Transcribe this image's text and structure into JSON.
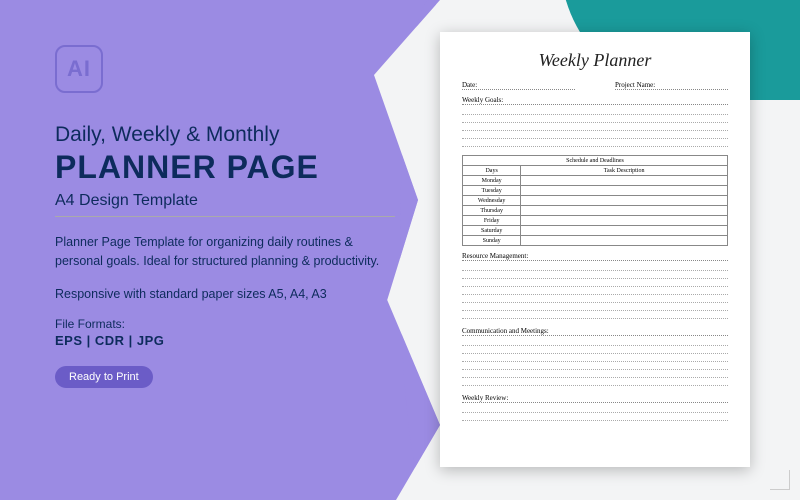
{
  "badge_text": "AI",
  "title_line1": "Daily, Weekly & Monthly",
  "title_line2": "PLANNER PAGE",
  "subtitle": "A4 Design Template",
  "desc1": "Planner Page Template for organizing daily routines & personal goals. Ideal for structured planning & productivity.",
  "desc2": "Responsive with standard paper sizes A5, A4, A3",
  "file_formats_label": "File Formats:",
  "file_formats": "EPS  |  CDR  |  JPG",
  "ready_badge": "Ready to Print",
  "planner": {
    "title": "Weekly Planner",
    "date_label": "Date:",
    "project_label": "Project Name:",
    "weekly_goals": "Weekly Goals:",
    "schedule_header": "Schedule and Deadlines",
    "col_days": "Days",
    "col_task": "Task Description",
    "days": [
      "Monday",
      "Tuesday",
      "Wednesday",
      "Thursday",
      "Friday",
      "Saturday",
      "Sunday"
    ],
    "resource_mgmt": "Resource Management:",
    "comm_meetings": "Communication and Meetings:",
    "weekly_review": "Weekly Review:"
  }
}
